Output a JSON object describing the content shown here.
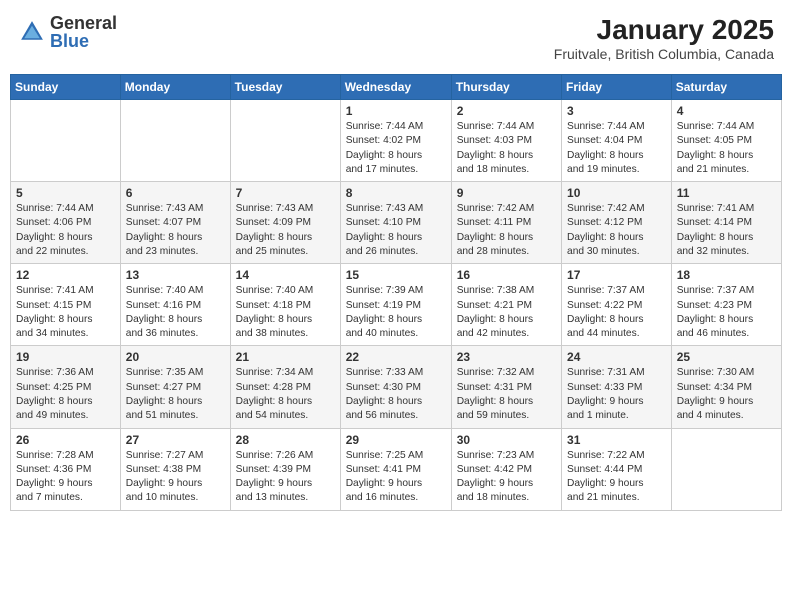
{
  "header": {
    "logo": {
      "general": "General",
      "blue": "Blue"
    },
    "title": "January 2025",
    "subtitle": "Fruitvale, British Columbia, Canada"
  },
  "calendar": {
    "weekdays": [
      "Sunday",
      "Monday",
      "Tuesday",
      "Wednesday",
      "Thursday",
      "Friday",
      "Saturday"
    ],
    "weeks": [
      [
        {
          "day": "",
          "info": ""
        },
        {
          "day": "",
          "info": ""
        },
        {
          "day": "",
          "info": ""
        },
        {
          "day": "1",
          "info": "Sunrise: 7:44 AM\nSunset: 4:02 PM\nDaylight: 8 hours\nand 17 minutes."
        },
        {
          "day": "2",
          "info": "Sunrise: 7:44 AM\nSunset: 4:03 PM\nDaylight: 8 hours\nand 18 minutes."
        },
        {
          "day": "3",
          "info": "Sunrise: 7:44 AM\nSunset: 4:04 PM\nDaylight: 8 hours\nand 19 minutes."
        },
        {
          "day": "4",
          "info": "Sunrise: 7:44 AM\nSunset: 4:05 PM\nDaylight: 8 hours\nand 21 minutes."
        }
      ],
      [
        {
          "day": "5",
          "info": "Sunrise: 7:44 AM\nSunset: 4:06 PM\nDaylight: 8 hours\nand 22 minutes."
        },
        {
          "day": "6",
          "info": "Sunrise: 7:43 AM\nSunset: 4:07 PM\nDaylight: 8 hours\nand 23 minutes."
        },
        {
          "day": "7",
          "info": "Sunrise: 7:43 AM\nSunset: 4:09 PM\nDaylight: 8 hours\nand 25 minutes."
        },
        {
          "day": "8",
          "info": "Sunrise: 7:43 AM\nSunset: 4:10 PM\nDaylight: 8 hours\nand 26 minutes."
        },
        {
          "day": "9",
          "info": "Sunrise: 7:42 AM\nSunset: 4:11 PM\nDaylight: 8 hours\nand 28 minutes."
        },
        {
          "day": "10",
          "info": "Sunrise: 7:42 AM\nSunset: 4:12 PM\nDaylight: 8 hours\nand 30 minutes."
        },
        {
          "day": "11",
          "info": "Sunrise: 7:41 AM\nSunset: 4:14 PM\nDaylight: 8 hours\nand 32 minutes."
        }
      ],
      [
        {
          "day": "12",
          "info": "Sunrise: 7:41 AM\nSunset: 4:15 PM\nDaylight: 8 hours\nand 34 minutes."
        },
        {
          "day": "13",
          "info": "Sunrise: 7:40 AM\nSunset: 4:16 PM\nDaylight: 8 hours\nand 36 minutes."
        },
        {
          "day": "14",
          "info": "Sunrise: 7:40 AM\nSunset: 4:18 PM\nDaylight: 8 hours\nand 38 minutes."
        },
        {
          "day": "15",
          "info": "Sunrise: 7:39 AM\nSunset: 4:19 PM\nDaylight: 8 hours\nand 40 minutes."
        },
        {
          "day": "16",
          "info": "Sunrise: 7:38 AM\nSunset: 4:21 PM\nDaylight: 8 hours\nand 42 minutes."
        },
        {
          "day": "17",
          "info": "Sunrise: 7:37 AM\nSunset: 4:22 PM\nDaylight: 8 hours\nand 44 minutes."
        },
        {
          "day": "18",
          "info": "Sunrise: 7:37 AM\nSunset: 4:23 PM\nDaylight: 8 hours\nand 46 minutes."
        }
      ],
      [
        {
          "day": "19",
          "info": "Sunrise: 7:36 AM\nSunset: 4:25 PM\nDaylight: 8 hours\nand 49 minutes."
        },
        {
          "day": "20",
          "info": "Sunrise: 7:35 AM\nSunset: 4:27 PM\nDaylight: 8 hours\nand 51 minutes."
        },
        {
          "day": "21",
          "info": "Sunrise: 7:34 AM\nSunset: 4:28 PM\nDaylight: 8 hours\nand 54 minutes."
        },
        {
          "day": "22",
          "info": "Sunrise: 7:33 AM\nSunset: 4:30 PM\nDaylight: 8 hours\nand 56 minutes."
        },
        {
          "day": "23",
          "info": "Sunrise: 7:32 AM\nSunset: 4:31 PM\nDaylight: 8 hours\nand 59 minutes."
        },
        {
          "day": "24",
          "info": "Sunrise: 7:31 AM\nSunset: 4:33 PM\nDaylight: 9 hours\nand 1 minute."
        },
        {
          "day": "25",
          "info": "Sunrise: 7:30 AM\nSunset: 4:34 PM\nDaylight: 9 hours\nand 4 minutes."
        }
      ],
      [
        {
          "day": "26",
          "info": "Sunrise: 7:28 AM\nSunset: 4:36 PM\nDaylight: 9 hours\nand 7 minutes."
        },
        {
          "day": "27",
          "info": "Sunrise: 7:27 AM\nSunset: 4:38 PM\nDaylight: 9 hours\nand 10 minutes."
        },
        {
          "day": "28",
          "info": "Sunrise: 7:26 AM\nSunset: 4:39 PM\nDaylight: 9 hours\nand 13 minutes."
        },
        {
          "day": "29",
          "info": "Sunrise: 7:25 AM\nSunset: 4:41 PM\nDaylight: 9 hours\nand 16 minutes."
        },
        {
          "day": "30",
          "info": "Sunrise: 7:23 AM\nSunset: 4:42 PM\nDaylight: 9 hours\nand 18 minutes."
        },
        {
          "day": "31",
          "info": "Sunrise: 7:22 AM\nSunset: 4:44 PM\nDaylight: 9 hours\nand 21 minutes."
        },
        {
          "day": "",
          "info": ""
        }
      ]
    ]
  }
}
